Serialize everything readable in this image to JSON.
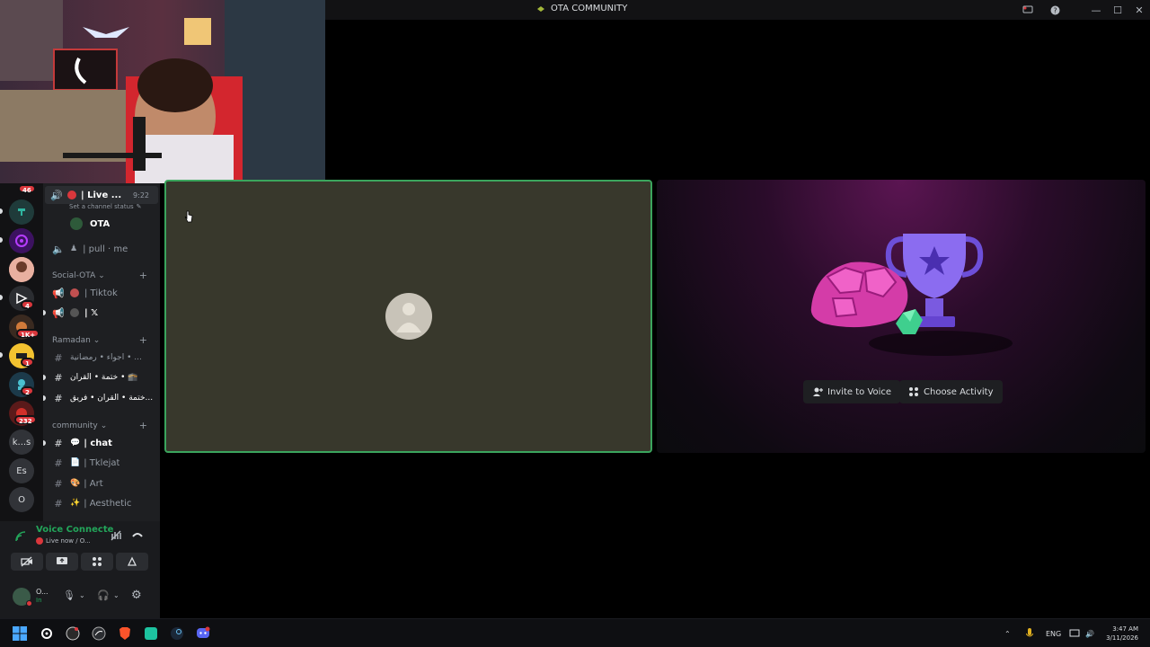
{
  "window": {
    "title": "OTA COMMUNITY"
  },
  "rail": {
    "badges": [
      "46",
      "4",
      "1K+",
      "1",
      "2",
      "232"
    ],
    "text_servers": [
      "k...s",
      "Es",
      "O"
    ]
  },
  "channels": {
    "voice_live": {
      "label": "| Live ...",
      "timer": "9:22",
      "status": "Set a channel status"
    },
    "voice_user": "OTA",
    "voice_pull": "| pull · me",
    "categories": [
      {
        "name": "Social-OTA"
      },
      {
        "name": "Ramadan"
      },
      {
        "name": "community"
      }
    ],
    "social": [
      {
        "label": "| Tiktok"
      },
      {
        "label": "| 𝕏"
      }
    ],
    "ramadan": [
      {
        "label": "اجواء • رمضانية • ..."
      },
      {
        "label": "ختمة • القرآن • 🕋"
      },
      {
        "label": "ختمة • القرآن • فريق..."
      }
    ],
    "community": [
      {
        "label": "| chat",
        "emoji": "💬"
      },
      {
        "label": "| Tklejat",
        "emoji": "📄"
      },
      {
        "label": "| Art",
        "emoji": "🎨"
      },
      {
        "label": "| Aesthetic",
        "emoji": "✨"
      }
    ]
  },
  "user_panel": {
    "voice_title": "Voice Connecte",
    "voice_sub": "Live now / O...",
    "username": "O...",
    "user_status": "In"
  },
  "activity": {
    "invite_label": "Invite to Voice",
    "choose_label": "Choose Activity"
  },
  "taskbar": {
    "lang": "ENG",
    "time": "3:47 AM",
    "date": "3/11/2026"
  },
  "colors": {
    "accent_green": "#23a55a",
    "tile_border": "#3ba55d",
    "badge_red": "#da373c"
  }
}
